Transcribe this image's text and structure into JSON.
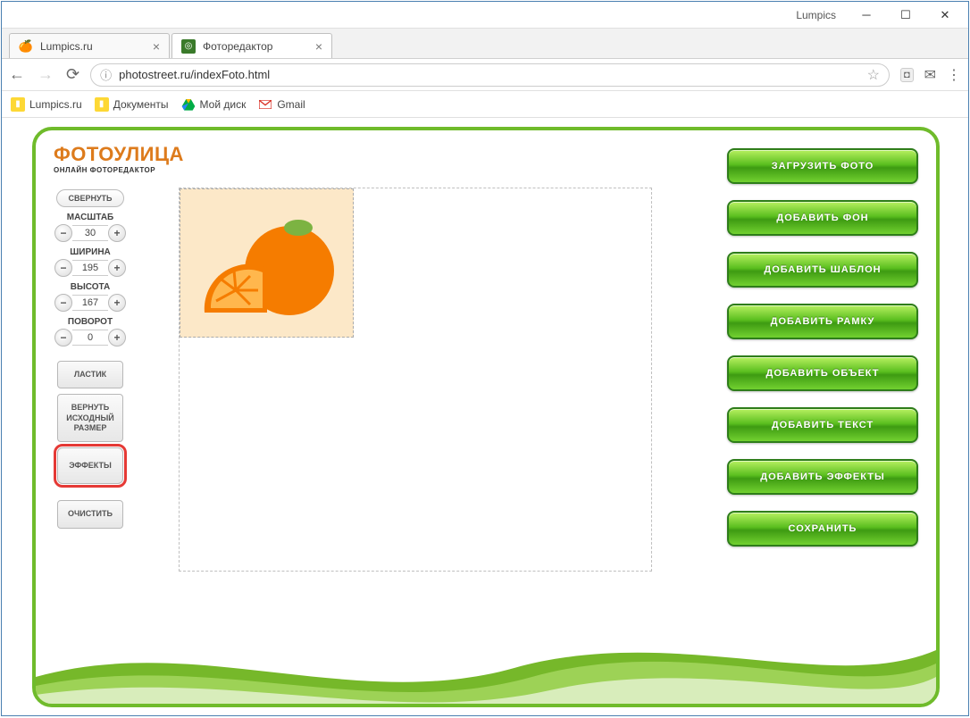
{
  "window": {
    "title": "Lumpics"
  },
  "tabs": [
    {
      "title": "Lumpics.ru",
      "favicon": "orange"
    },
    {
      "title": "Фоторедактор",
      "favicon": "app"
    }
  ],
  "address": {
    "url": "photostreet.ru/indexFoto.html"
  },
  "bookmarks": [
    {
      "label": "Lumpics.ru"
    },
    {
      "label": "Документы"
    },
    {
      "label": "Мой диск"
    },
    {
      "label": "Gmail"
    }
  ],
  "logo": {
    "main": "ФОТОУЛИЦА",
    "sub": "ОНЛАЙН ФОТОРЕДАКТОР"
  },
  "left": {
    "collapse": "СВЕРНУТЬ",
    "scale": {
      "label": "МАСШТАБ",
      "value": "30"
    },
    "width": {
      "label": "ШИРИНА",
      "value": "195"
    },
    "height": {
      "label": "ВЫСОТА",
      "value": "167"
    },
    "rotate": {
      "label": "ПОВОРОТ",
      "value": "0"
    },
    "eraser": "ЛАСТИК",
    "reset": "ВЕРНУТЬ ИСХОДНЫЙ РАЗМЕР",
    "effects": "ЭФФЕКТЫ",
    "clear": "ОЧИСТИТЬ"
  },
  "right": {
    "upload": "ЗАГРУЗИТЬ ФОТО",
    "add_bg": "ДОБАВИТЬ  ФОН",
    "add_template": "ДОБАВИТЬ  ШАБЛОН",
    "add_frame": "ДОБАВИТЬ  РАМКУ",
    "add_object": "ДОБАВИТЬ  ОБЪЕКТ",
    "add_text": "ДОБАВИТЬ  ТЕКСТ",
    "add_effects": "ДОБАВИТЬ  ЭФФЕКТЫ",
    "save": "СОХРАНИТЬ"
  }
}
